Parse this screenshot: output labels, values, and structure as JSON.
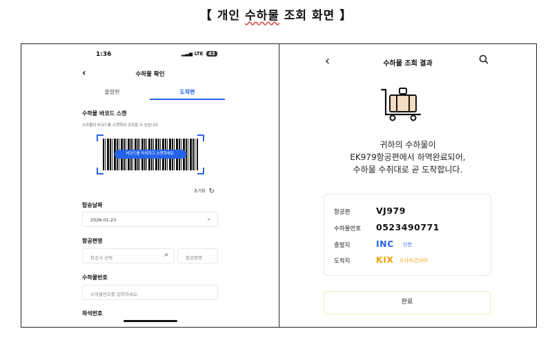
{
  "doc_title": {
    "open_bracket": "【",
    "word1": "개인",
    "word2": "수하물",
    "word3": "조회",
    "word4": "화면",
    "close_bracket": "】"
  },
  "left_screen": {
    "status_time": "1:36",
    "status_signal": "LTE",
    "status_battery": "43",
    "header_title": "수하물 확인",
    "tabs": [
      {
        "label": "출발편",
        "active": false
      },
      {
        "label": "도착편",
        "active": true
      }
    ],
    "barcode_section": {
      "label": "수하물 바코드 스캔",
      "desc": "수하물의 바코드를 스캔하여 조회할 수 있습니다.",
      "scan_button": "바코드를 터치하고 스캔하세요."
    },
    "reset_label": "초기화",
    "date_section": {
      "label": "탑승날짜",
      "value": "2026.01.23"
    },
    "flight_section": {
      "label": "항공편명",
      "airline_placeholder": "항공사 선택",
      "flight_placeholder": "항공편명"
    },
    "baggage_section": {
      "label": "수하물번호",
      "placeholder": "수하물번호를 입력하세요."
    },
    "seat_section": {
      "label": "좌석번호"
    }
  },
  "right_screen": {
    "header_title": "수하물 조회 결과",
    "message_lines": [
      "귀하의 수하물이",
      "EK979항공편에서 하역완료되어,",
      "수하물 수취대로 곧 도착합니다."
    ],
    "info": {
      "flight_key": "항공편",
      "flight_value": "VJ979",
      "baggage_key": "수하물번호",
      "baggage_value": "0523490771",
      "origin_key": "출발지",
      "origin_code": "INC",
      "origin_name": "인천",
      "dest_key": "도착지",
      "dest_code": "KIX",
      "dest_name": "오사카/간사이"
    },
    "done_button": "완료"
  },
  "colors": {
    "accent_blue": "#2563eb",
    "accent_orange": "#f59e0b",
    "button_border": "#f5ecb0"
  },
  "icons": [
    "back-arrow-icon",
    "search-icon",
    "chevron-down-icon",
    "refresh-icon",
    "luggage-cart-icon"
  ]
}
